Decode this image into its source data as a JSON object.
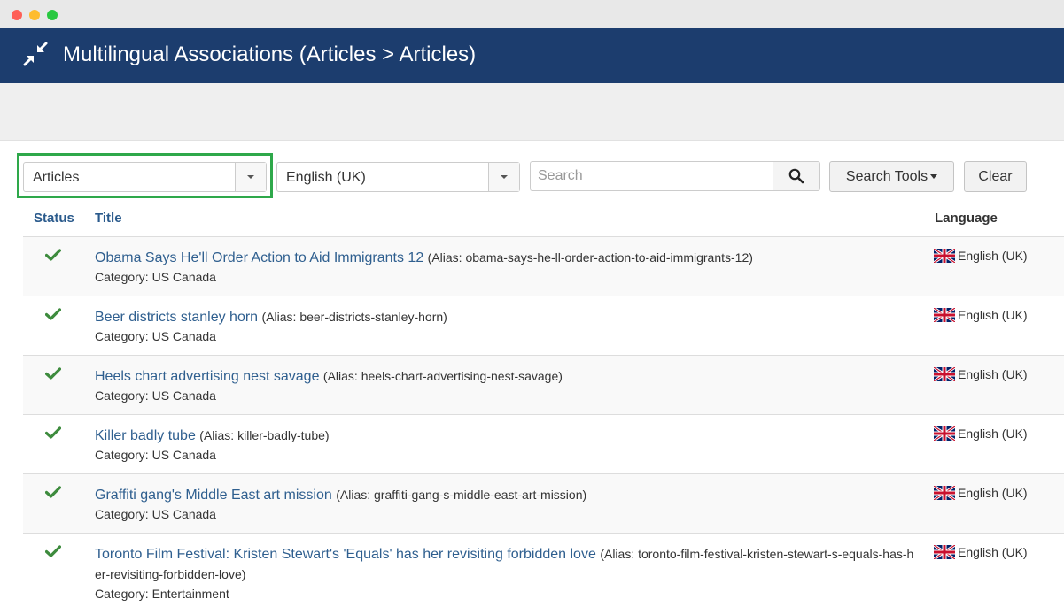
{
  "window": {
    "title": "Multilingual Associations (Articles > Articles)"
  },
  "filters": {
    "item_type": "Articles",
    "language": "English (UK)",
    "search_placeholder": "Search",
    "search_tools_label": "Search Tools",
    "clear_label": "Clear"
  },
  "table": {
    "headers": {
      "status": "Status",
      "title": "Title",
      "language": "Language"
    },
    "rows": [
      {
        "title": "Obama Says He'll Order Action to Aid Immigrants 12",
        "alias": "(Alias: obama-says-he-ll-order-action-to-aid-immigrants-12)",
        "category": "Category: US Canada",
        "language": "English (UK)"
      },
      {
        "title": "Beer districts stanley horn",
        "alias": "(Alias: beer-districts-stanley-horn)",
        "category": "Category: US Canada",
        "language": "English (UK)"
      },
      {
        "title": "Heels chart advertising nest savage",
        "alias": "(Alias: heels-chart-advertising-nest-savage)",
        "category": "Category: US Canada",
        "language": "English (UK)"
      },
      {
        "title": "Killer badly tube",
        "alias": "(Alias: killer-badly-tube)",
        "category": "Category: US Canada",
        "language": "English (UK)"
      },
      {
        "title": "Graffiti gang's Middle East art mission",
        "alias": "(Alias: graffiti-gang-s-middle-east-art-mission)",
        "category": "Category: US Canada",
        "language": "English (UK)"
      },
      {
        "title": "Toronto Film Festival: Kristen Stewart's 'Equals' has her revisiting forbidden love",
        "alias": "(Alias: toronto-film-festival-kristen-stewart-s-equals-has-her-revisiting-forbidden-love)",
        "category": "Category: Entertainment",
        "language": "English (UK)"
      }
    ]
  },
  "colors": {
    "header_bg": "#1c3d6e",
    "link": "#2f5f8f",
    "check": "#3d8b3d",
    "highlight": "#2ea84a"
  }
}
